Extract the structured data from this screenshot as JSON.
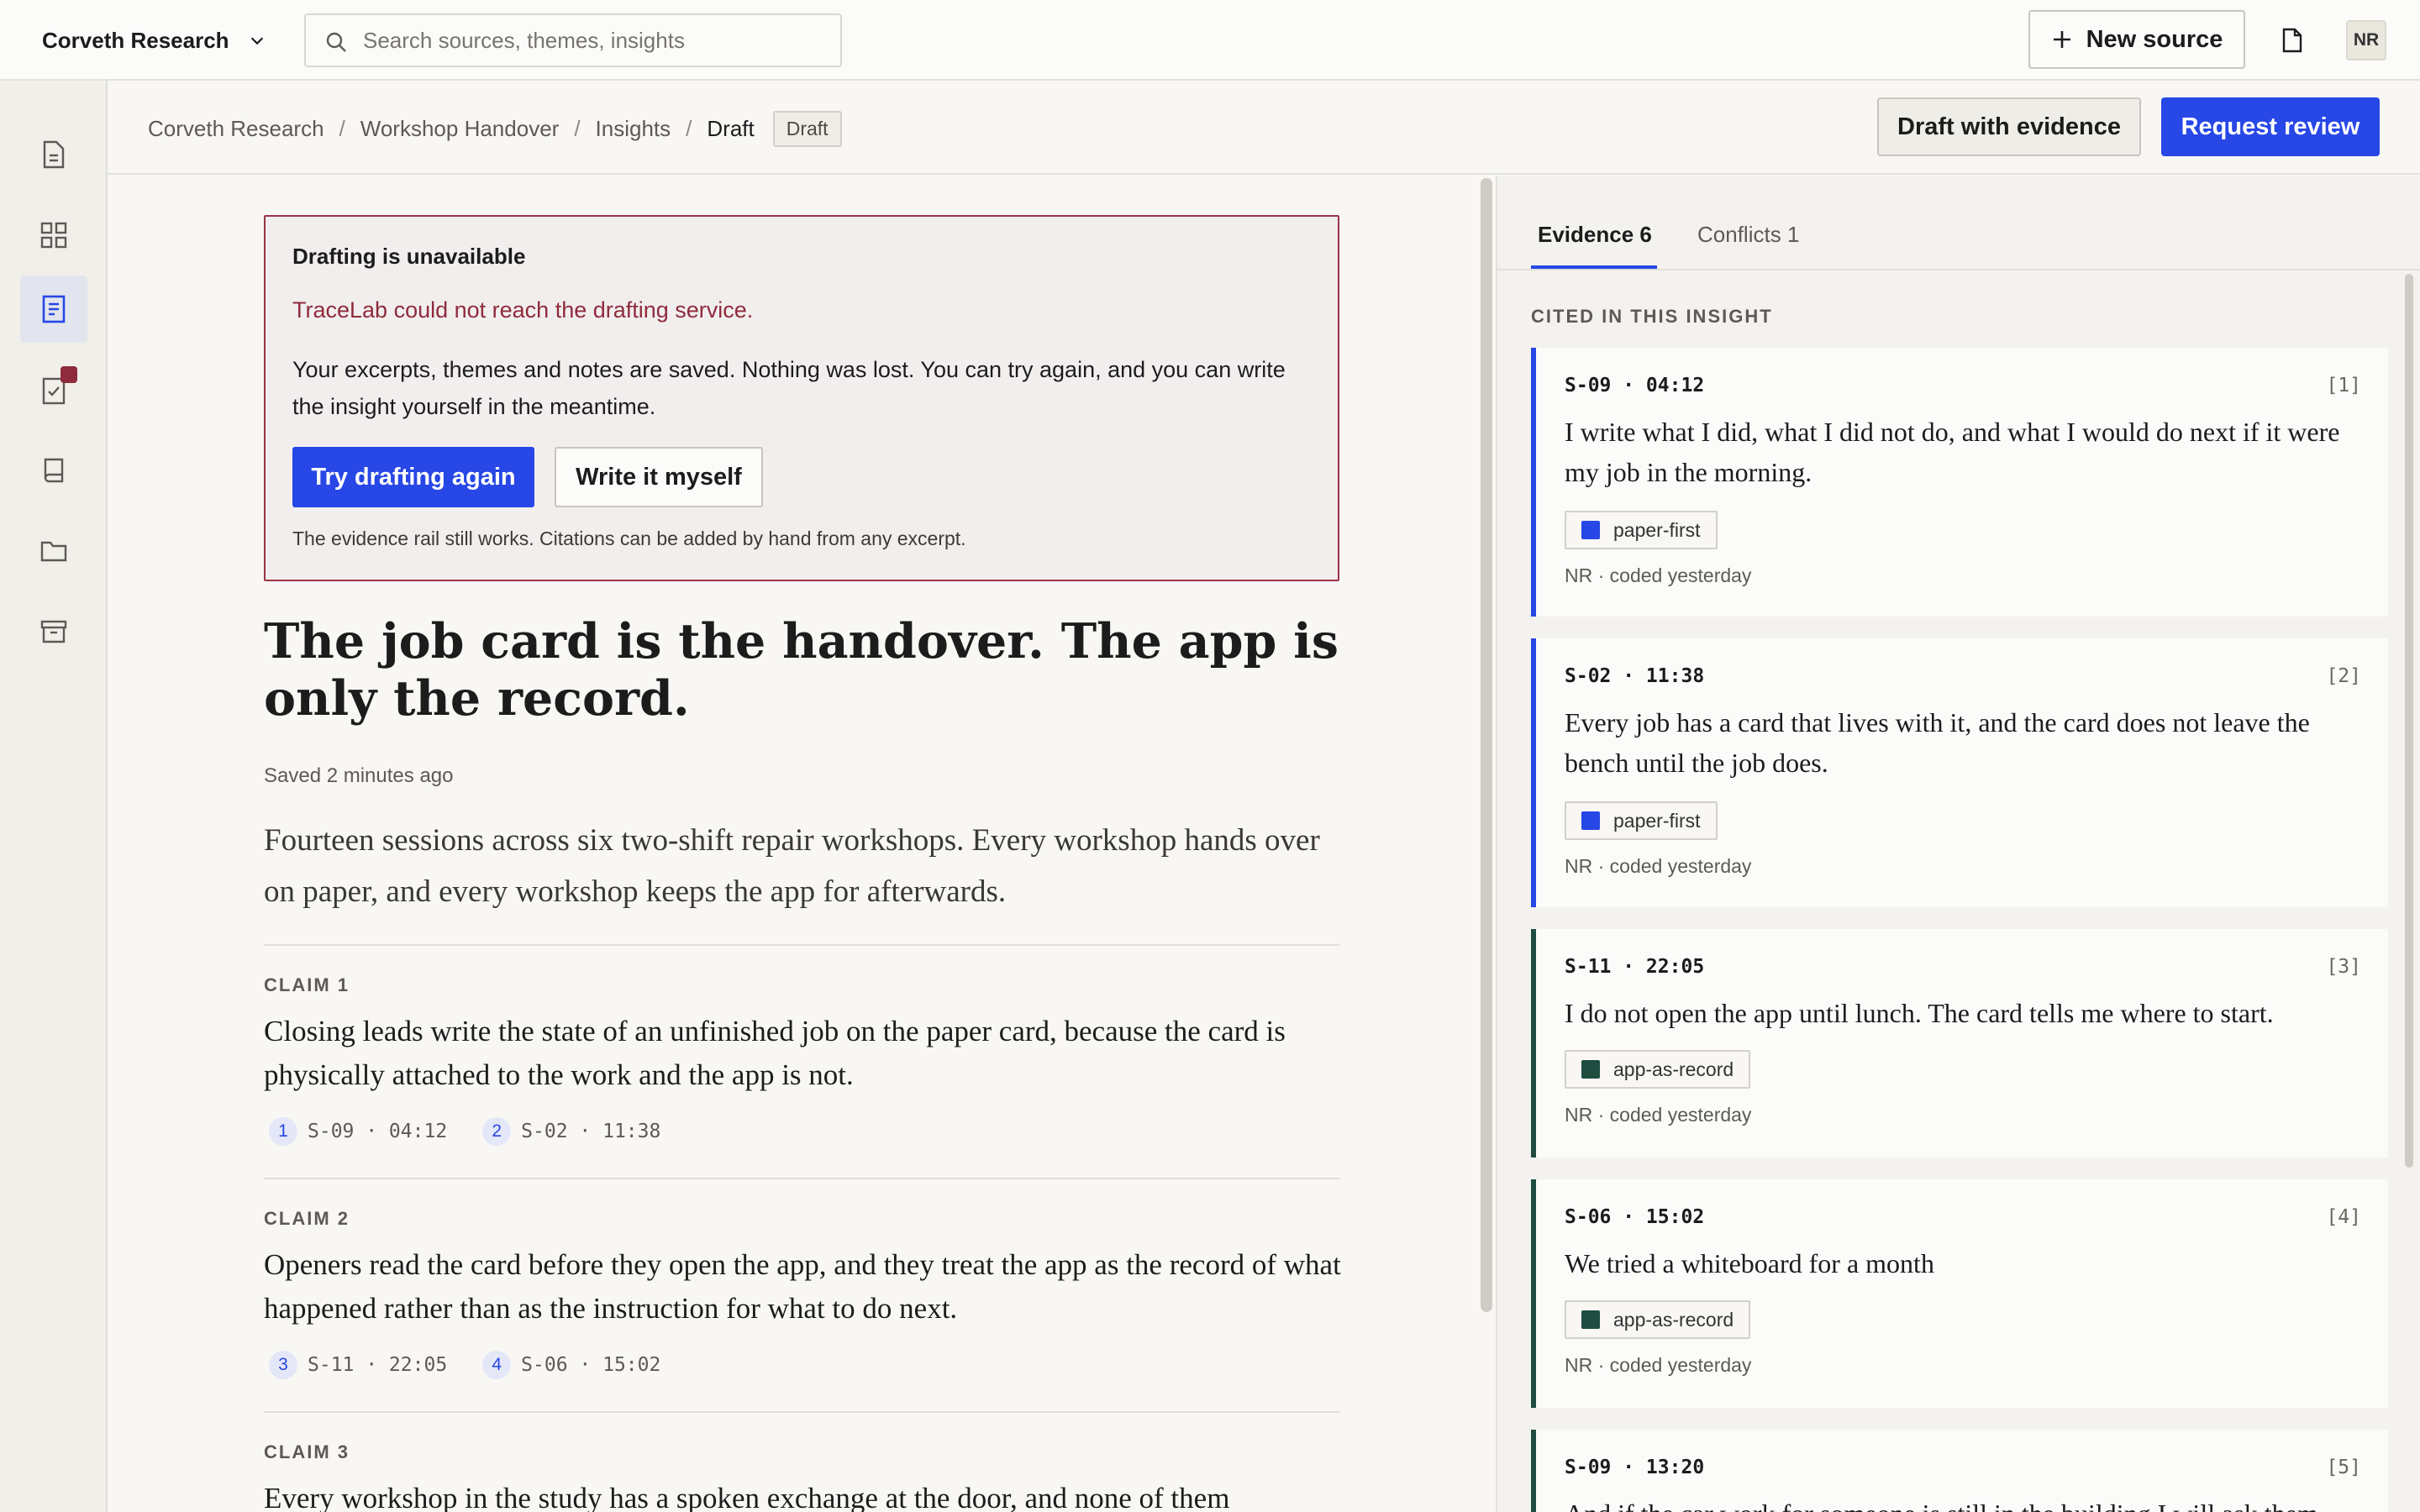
{
  "topbar": {
    "workspace": "Corveth Research",
    "search_placeholder": "Search sources, themes, insights",
    "new_source_label": "New source",
    "avatar_initials": "NR"
  },
  "breadcrumb": {
    "items": [
      "Corveth Research",
      "Workshop Handover",
      "Insights",
      "Draft"
    ],
    "status_chip": "Draft"
  },
  "actions": {
    "draft_with_evidence": "Draft with evidence",
    "request_review": "Request review"
  },
  "alert": {
    "title": "Drafting is unavailable",
    "reason": "TraceLab could not reach the drafting service.",
    "body": "Your excerpts, themes and notes are saved. Nothing was lost. You can try again, and you can write the insight yourself in the meantime.",
    "try_again": "Try drafting again",
    "write_myself": "Write it myself",
    "footnote": "The evidence rail still works. Citations can be added by hand from any excerpt."
  },
  "document": {
    "title": "The job card is the handover. The app is only the record.",
    "saved": "Saved 2 minutes ago",
    "lede": "Fourteen sessions across six two-shift repair workshops. Every workshop hands over on paper, and every workshop keeps the app for afterwards.",
    "claims": [
      {
        "label": "CLAIM 1",
        "text": "Closing leads write the state of an unfinished job on the paper card, because the card is physically attached to the work and the app is not.",
        "cites": [
          {
            "num": "1",
            "ref": "S-09 · 04:12"
          },
          {
            "num": "2",
            "ref": "S-02 · 11:38"
          }
        ]
      },
      {
        "label": "CLAIM 2",
        "text": "Openers read the card before they open the app, and they treat the app as the record of what happened rather than as the instruction for what to do next.",
        "cites": [
          {
            "num": "3",
            "ref": "S-11 · 22:05"
          },
          {
            "num": "4",
            "ref": "S-06 · 15:02"
          }
        ]
      },
      {
        "label": "CLAIM 3",
        "text": "Every workshop in the study has a spoken exchange at the door, and none of them"
      }
    ]
  },
  "panel": {
    "tabs": [
      {
        "label": "Evidence",
        "count": "6"
      },
      {
        "label": "Conflicts",
        "count": "1"
      }
    ],
    "section_heading": "CITED IN THIS INSIGHT",
    "cards": [
      {
        "meta": "S-09 · 04:12",
        "ref": "[1]",
        "quote": "I write what I did, what I did not do, and what I would do next if it were my job in the morning.",
        "tag": "paper-first",
        "tag_color": "#2747e6",
        "coded": "NR · coded yesterday"
      },
      {
        "meta": "S-02 · 11:38",
        "ref": "[2]",
        "quote": "Every job has a card that lives with it, and the card does not leave the bench until the job does.",
        "tag": "paper-first",
        "tag_color": "#2747e6",
        "coded": "NR · coded yesterday"
      },
      {
        "meta": "S-11 · 22:05",
        "ref": "[3]",
        "quote": "I do not open the app until lunch. The card tells me where to start.",
        "tag": "app-as-record",
        "tag_color": "#1f4d40",
        "coded": "NR · coded yesterday"
      },
      {
        "meta": "S-06 · 15:02",
        "ref": "[4]",
        "quote": "We tried a whiteboard for a month",
        "tag": "app-as-record",
        "tag_color": "#1f4d40",
        "coded": "NR · coded yesterday"
      },
      {
        "meta": "S-09 · 13:20",
        "ref": "[5]",
        "quote": "And if the car work for someone is still in the building I will ask them"
      }
    ]
  },
  "colors": {
    "accent": "#2747e6",
    "alert_border": "#9b3447",
    "alert_text": "#8e2b3c",
    "theme_green": "#1f4d40"
  }
}
